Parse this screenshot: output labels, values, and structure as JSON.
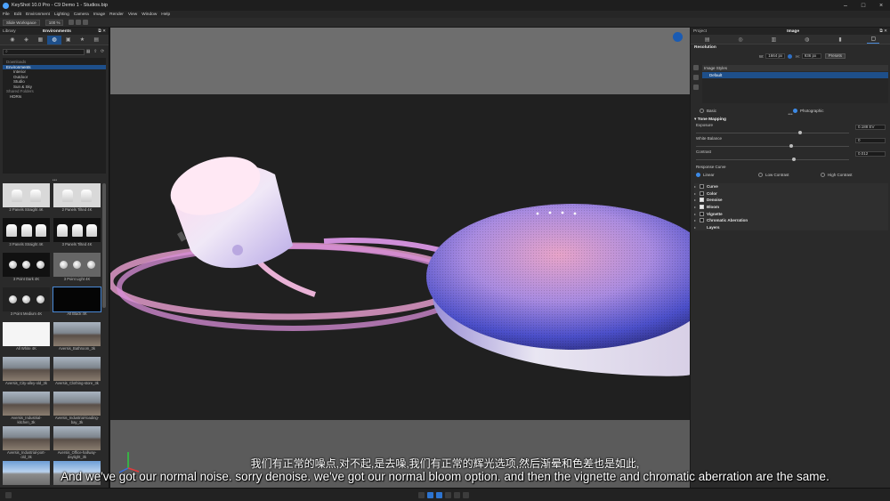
{
  "window": {
    "title": "KeyShot 10.0 Pro  -  C9 Demo 1 - Studios.bip",
    "controls": [
      "–",
      "□",
      "×"
    ]
  },
  "menu": [
    "File",
    "Edit",
    "Environment",
    "Lighting",
    "Camera",
    "Image",
    "Render",
    "View",
    "Window",
    "Help"
  ],
  "toolbar": {
    "workspace_label": "Slide Workspace",
    "zoom_label": "100 %"
  },
  "library": {
    "panel_label": "Library",
    "title": "Environments",
    "search_placeholder": "",
    "tree": [
      {
        "label": "Downloads",
        "indent": 1,
        "state": "dim"
      },
      {
        "label": "Environments",
        "indent": 1,
        "state": "sel"
      },
      {
        "label": "Interior",
        "indent": 3,
        "state": ""
      },
      {
        "label": "Outdoor",
        "indent": 3,
        "state": ""
      },
      {
        "label": "Studio",
        "indent": 3,
        "state": ""
      },
      {
        "label": "Sun & Sky",
        "indent": 3,
        "state": ""
      },
      {
        "label": "Shared Folders",
        "indent": 1,
        "state": "dim"
      },
      {
        "label": "HDRIs",
        "indent": 2,
        "state": ""
      }
    ],
    "thumbnails": [
      {
        "label": "2 Panels Straight 4K",
        "kind": "panels"
      },
      {
        "label": "2 Panels Tilted 4K",
        "kind": "panels"
      },
      {
        "label": "3 Panels Straight 4K",
        "kind": "panels3"
      },
      {
        "label": "3 Panels Tilted 4K",
        "kind": "panels3"
      },
      {
        "label": "3 Point Dark 4K",
        "kind": "balls"
      },
      {
        "label": "3 Point Light 4K",
        "kind": "balls-light"
      },
      {
        "label": "3 Point Medium 4K",
        "kind": "balls-med"
      },
      {
        "label": "All Black 4K",
        "kind": "black"
      },
      {
        "label": "All White 4K",
        "kind": "white"
      },
      {
        "label": "Aversis_Bathroom_3k",
        "kind": "pano"
      },
      {
        "label": "Aversis_City-alley-old_3k",
        "kind": "pano"
      },
      {
        "label": "Aversis_Clothing-store_3k",
        "kind": "pano"
      },
      {
        "label": "Aversis_Industrial-kitchen_3k",
        "kind": "pano"
      },
      {
        "label": "Aversis_Industrial-loading-bay_3k",
        "kind": "pano"
      },
      {
        "label": "Aversis_Industrial-port-old_3k",
        "kind": "pano"
      },
      {
        "label": "Aversis_Office-hallway-daylight_3k",
        "kind": "pano"
      },
      {
        "label": "",
        "kind": "sky"
      },
      {
        "label": "",
        "kind": "sky"
      }
    ]
  },
  "project": {
    "panel_label": "Project",
    "title": "Image",
    "resolution": {
      "section": "Resolution",
      "width_label": "W:",
      "width_value": "1664 px",
      "height_label": "H:",
      "height_value": "936 px",
      "presets_label": "Presets"
    },
    "image_styles": {
      "header": "Image Styles",
      "selected": "Default"
    },
    "mode": {
      "basic_label": "Basic",
      "photographic_label": "Photographic",
      "selected": "Photographic"
    },
    "tone_mapping": {
      "section": "Tone Mapping",
      "params": [
        {
          "label": "Exposure",
          "value": "0.188 EV",
          "level": 0.68
        },
        {
          "label": "White Balance",
          "value": "0",
          "level": 0.62
        },
        {
          "label": "Contrast",
          "value": "0.012",
          "level": 0.64
        }
      ],
      "response_curve_label": "Response Curve",
      "curves": [
        {
          "label": "Linear",
          "on": true
        },
        {
          "label": "Low Contrast",
          "on": false
        },
        {
          "label": "High Contrast",
          "on": false
        }
      ]
    },
    "effects": [
      {
        "label": "Curve",
        "checked": false
      },
      {
        "label": "Color",
        "checked": false
      },
      {
        "label": "Denoise",
        "checked": true
      },
      {
        "label": "Bloom",
        "checked": true
      },
      {
        "label": "Vignette",
        "checked": false
      },
      {
        "label": "Chromatic Aberration",
        "checked": false
      },
      {
        "label": "Layers",
        "checked": null
      }
    ]
  },
  "subtitles": {
    "zh": "我们有正常的噪点,对不起,是去噪,我们有正常的辉光选项,然后渐晕和色差也是如此,",
    "en": "And we've got our normal noise. sorry denoise. we've got our normal bloom option. and then the vignette and chromatic aberration are the same."
  }
}
